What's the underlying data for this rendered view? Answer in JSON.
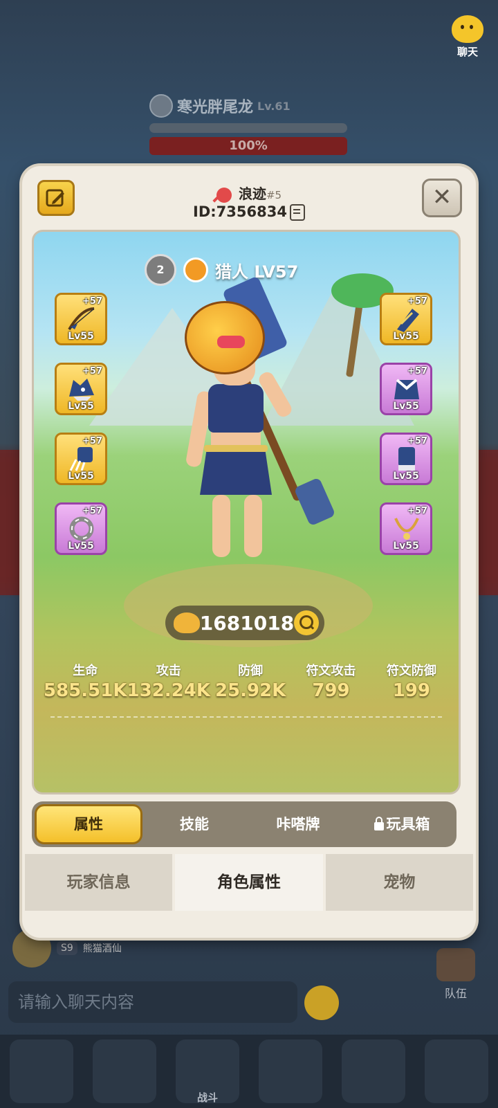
{
  "background": {
    "chat_label": "聊天",
    "boss": {
      "name": "寒光胖尾龙",
      "level": "Lv.61",
      "hp_percent_text": "100%"
    },
    "player_tag": "S9",
    "player_name": "熊猫酒仙",
    "chat_placeholder": "请输入聊天内容",
    "team_label": "队伍",
    "nav_battle_label": "战斗"
  },
  "header": {
    "player_name": "浪迹",
    "rank": "#5",
    "player_id": "ID:7356834"
  },
  "character": {
    "class_name": "猎人 LV57",
    "badge_text": "2"
  },
  "gear_left": [
    {
      "plus": "+57",
      "level": "Lv55",
      "rarity": "gold",
      "icon": "bow-icon"
    },
    {
      "plus": "+57",
      "level": "Lv55",
      "rarity": "gold",
      "icon": "wolf-helmet-icon"
    },
    {
      "plus": "+57",
      "level": "Lv55",
      "rarity": "gold",
      "icon": "claw-glove-icon"
    },
    {
      "plus": "+57",
      "level": "Lv55",
      "rarity": "purple",
      "icon": "ring-icon"
    }
  ],
  "gear_right": [
    {
      "plus": "+57",
      "level": "Lv55",
      "rarity": "gold",
      "icon": "bracer-icon"
    },
    {
      "plus": "+57",
      "level": "Lv55",
      "rarity": "purple",
      "icon": "armor-icon"
    },
    {
      "plus": "+57",
      "level": "Lv55",
      "rarity": "purple",
      "icon": "gauntlet-icon"
    },
    {
      "plus": "+57",
      "level": "Lv55",
      "rarity": "purple",
      "icon": "necklace-icon"
    }
  ],
  "power": "1681018",
  "stats": [
    {
      "label": "生命",
      "value": "585.51K"
    },
    {
      "label": "攻击",
      "value": "132.24K"
    },
    {
      "label": "防御",
      "value": "25.92K"
    },
    {
      "label": "符文攻击",
      "value": "799"
    },
    {
      "label": "符文防御",
      "value": "199"
    }
  ],
  "sub_tabs": [
    "属性",
    "技能",
    "咔嗒牌",
    "玩具箱"
  ],
  "main_tabs": [
    "玩家信息",
    "角色属性",
    "宠物"
  ],
  "colors": {
    "gold": "#f4c02a",
    "purple": "#c87ad6",
    "stat_value": "#fbe48b"
  }
}
